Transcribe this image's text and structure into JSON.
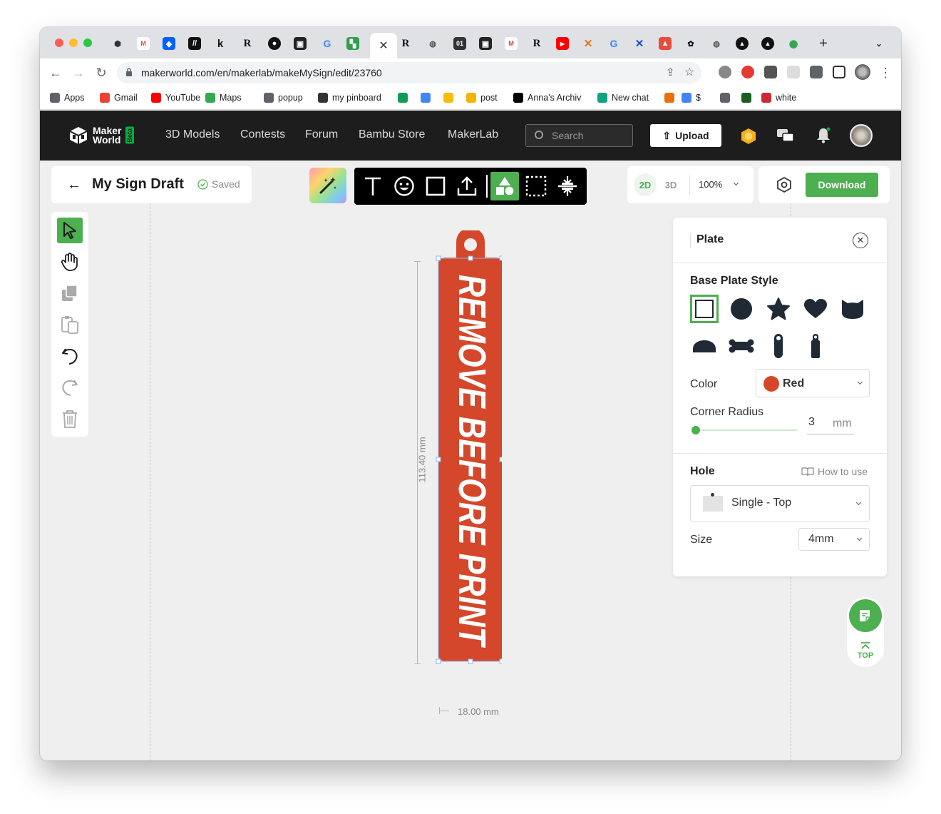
{
  "browser": {
    "url": "makerworld.com/en/makerlab/makeMySign/edit/23760",
    "active_tab_icon": "close-icon",
    "bookmarks": [
      {
        "label": "Apps",
        "icon": "apps-grid-icon",
        "color": "#5f6368"
      },
      {
        "label": "Gmail",
        "icon": "gmail-icon",
        "color": "#ea4335"
      },
      {
        "label": "YouTube",
        "icon": "youtube-icon",
        "color": "#ff0000"
      },
      {
        "label": "Maps",
        "icon": "maps-icon",
        "color": "#34a853"
      },
      {
        "label": "popup",
        "icon": "globe-icon",
        "color": "#5f6368"
      },
      {
        "label": "my pinboard",
        "icon": "pin-icon",
        "color": "#333333"
      },
      {
        "label": "",
        "icon": "sheets-icon",
        "color": "#0f9d58"
      },
      {
        "label": "",
        "icon": "calendar-icon",
        "color": "#4285f4"
      },
      {
        "label": "",
        "icon": "drive-icon",
        "color": "#fbbc04"
      },
      {
        "label": "post",
        "icon": "post-icon",
        "color": "#f4b400"
      },
      {
        "label": "Anna's Archiv",
        "icon": "annas-archive-icon",
        "color": "#000000"
      },
      {
        "label": "New chat",
        "icon": "chatgpt-icon",
        "color": "#10a37f"
      },
      {
        "label": "",
        "icon": "x-orange-icon",
        "color": "#e8710a"
      },
      {
        "label": "$",
        "icon": "dollar-bookmark-icon",
        "color": "#4285f4"
      },
      {
        "label": "",
        "icon": "globe-icon",
        "color": "#5f6368"
      },
      {
        "label": "",
        "icon": "s-icon",
        "color": "#1b5e20"
      },
      {
        "label": "white",
        "icon": "zotero-icon",
        "color": "#cc2936"
      }
    ]
  },
  "site": {
    "logo_line1": "Maker",
    "logo_line2": "World",
    "logo_badge": "Beta",
    "nav": [
      "3D Models",
      "Contests",
      "Forum",
      "Bambu Store",
      "MakerLab"
    ],
    "search_placeholder": "Search",
    "upload_label": "Upload"
  },
  "editor": {
    "title": "My Sign Draft",
    "saved_label": "Saved",
    "view_2d": "2D",
    "view_3d": "3D",
    "zoom": "100%",
    "download_label": "Download",
    "tools": [
      "text-tool-icon",
      "emoji-tool-icon",
      "shape-tool-icon",
      "upload-image-icon",
      "plate-tool-icon",
      "select-area-icon",
      "align-center-icon"
    ],
    "left_tools": [
      "select-cursor-icon",
      "hand-pan-icon",
      "duplicate-icon",
      "paste-icon",
      "undo-icon",
      "redo-icon",
      "trash-icon"
    ]
  },
  "sign": {
    "text": "REMOVE BEFORE PRINT",
    "height_label": "113.40 mm",
    "width_label": "18.00 mm",
    "color": "#d4472a"
  },
  "panel": {
    "title": "Plate",
    "base_plate_style_label": "Base Plate Style",
    "shapes": [
      "square-shape-icon",
      "circle-shape-icon",
      "star-shape-icon",
      "heart-shape-icon",
      "cat-shape-icon",
      "arch-shape-icon",
      "bone-shape-icon",
      "tag-round-shape-icon",
      "tag-hook-shape-icon"
    ],
    "color_label": "Color",
    "color_value": "Red",
    "color_hex": "#d4472a",
    "corner_radius_label": "Corner Radius",
    "corner_radius_value": "3",
    "corner_radius_unit": "mm",
    "hole_label": "Hole",
    "how_to_use": "How to use",
    "hole_value": "Single - Top",
    "size_label": "Size",
    "size_value": "4mm"
  },
  "top_button_label": "TOP",
  "accent": "#4caf50"
}
